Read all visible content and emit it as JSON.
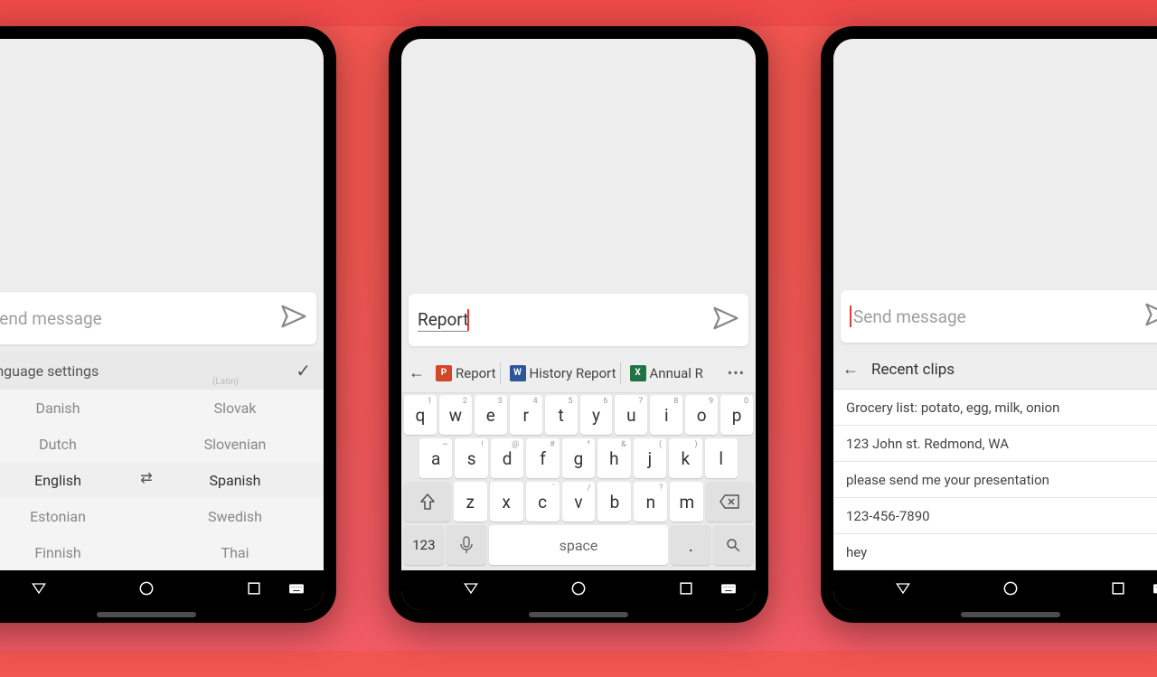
{
  "colors": {
    "accent": "#e53935"
  },
  "phone_left": {
    "input": {
      "placeholder": "Send message"
    },
    "panel_title": "Language settings",
    "lang_left": [
      "Danish",
      "Dutch",
      "English",
      "Estonian",
      "Finnish"
    ],
    "lang_right_dim": "(Latin)",
    "lang_right": [
      "Slovak",
      "Slovenian",
      "Spanish",
      "Swedish",
      "Thai"
    ],
    "selected_left_idx": 2,
    "selected_right_idx": 2
  },
  "phone_center": {
    "input_value": "Report",
    "strip": {
      "items": [
        {
          "icon": "pp",
          "icon_label": "P",
          "label": "Report"
        },
        {
          "icon": "wd",
          "icon_label": "W",
          "label": "History Report"
        },
        {
          "icon": "xl",
          "icon_label": "X",
          "label": "Annual R"
        }
      ],
      "menu": "•••"
    },
    "keyboard": {
      "row1": [
        {
          "k": "q",
          "s": "1"
        },
        {
          "k": "w",
          "s": "2"
        },
        {
          "k": "e",
          "s": "3"
        },
        {
          "k": "r",
          "s": "4"
        },
        {
          "k": "t",
          "s": "5"
        },
        {
          "k": "y",
          "s": "6"
        },
        {
          "k": "u",
          "s": "7"
        },
        {
          "k": "i",
          "s": "8"
        },
        {
          "k": "o",
          "s": "9"
        },
        {
          "k": "p",
          "s": "0"
        }
      ],
      "row2": [
        {
          "k": "a",
          "s": "~"
        },
        {
          "k": "s",
          "s": "!"
        },
        {
          "k": "d",
          "s": "@"
        },
        {
          "k": "f",
          "s": "#"
        },
        {
          "k": "g",
          "s": "^"
        },
        {
          "k": "h",
          "s": "&"
        },
        {
          "k": "j",
          "s": "("
        },
        {
          "k": "k",
          "s": ")"
        },
        {
          "k": "l",
          "s": ""
        }
      ],
      "row3": [
        {
          "k": "z",
          "s": ""
        },
        {
          "k": "x",
          "s": ""
        },
        {
          "k": "c",
          "s": "'"
        },
        {
          "k": "v",
          "s": "/"
        },
        {
          "k": "b",
          "s": ""
        },
        {
          "k": "n",
          "s": "?"
        },
        {
          "k": "m",
          "s": ""
        }
      ],
      "k123": "123",
      "space": "space",
      "dot": "."
    }
  },
  "phone_right": {
    "input": {
      "placeholder": "Send message"
    },
    "clips_title": "Recent clips",
    "clips": [
      "Grocery list: potato, egg, milk, onion",
      "123 John st. Redmond, WA",
      "please send me your presentation",
      "123-456-7890",
      "hey"
    ]
  }
}
